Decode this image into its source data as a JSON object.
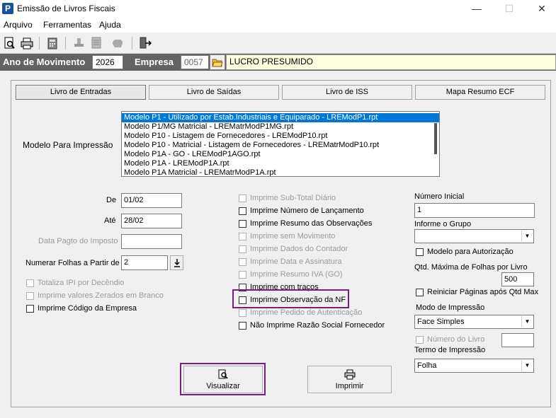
{
  "window": {
    "title": "Emissão de Livros Fiscais",
    "app_icon": "P"
  },
  "menu": [
    "Arquivo",
    "Ferramentas",
    "Ajuda"
  ],
  "header": {
    "ano_label": "Ano de Movimento",
    "ano_value": "2026",
    "empresa_label": "Empresa",
    "empresa_code": "0057",
    "empresa_name": "LUCRO PRESUMIDO"
  },
  "tabs": [
    "Livro de Entradas",
    "Livro de Saídas",
    "Livro de ISS",
    "Mapa Resumo ECF"
  ],
  "modelo": {
    "label": "Modelo Para Impressão",
    "items": [
      "Modelo P1 - Utilizado por Estab.Industriais e Equiparado - LREModP1.rpt",
      "Modelo P1/MG Matricial - LREMatrModP1MG.rpt",
      "Modelo P10 - Listagem de Fornecedores - LREModP10.rpt",
      "Modelo P10 - Matricial - Listagem de Fornecedores - LREMatrModP10.rpt",
      "Modelo P1A - GO - LREModP1AGO.rpt",
      "Modelo P1A - LREModP1A.rpt",
      "Modelo P1A Matricial - LREMatrModP1A.rpt"
    ]
  },
  "left": {
    "de_label": "De",
    "de_value": "01/02",
    "ate_label": "Até",
    "ate_value": "28/02",
    "data_pagto_label": "Data Pagto do Imposto",
    "data_pagto_value": "",
    "numerar_label": "Numerar Folhas a Partir de",
    "numerar_value": "2",
    "checks": [
      {
        "label": "Totaliza IPI por Decêndio",
        "disabled": true
      },
      {
        "label": "Imprime valores Zerados em Branco",
        "disabled": true
      },
      {
        "label": "Imprime Código da Empresa",
        "disabled": false
      }
    ]
  },
  "middle_checks": [
    {
      "label": "Imprime Sub-Total Diário",
      "disabled": true
    },
    {
      "label": "Imprime Número de Lançamento",
      "disabled": false
    },
    {
      "label": "Imprime Resumo das Observações",
      "disabled": false
    },
    {
      "label": "Imprime sem Movimento",
      "disabled": true
    },
    {
      "label": "Imprime Dados do Contador",
      "disabled": true
    },
    {
      "label": "Imprime Data e Assinatura",
      "disabled": true
    },
    {
      "label": "Imprime Resumo IVA (GO)",
      "disabled": true
    },
    {
      "label": "Imprime com traços",
      "disabled": false
    },
    {
      "label": "Imprime Observação da NF",
      "disabled": false
    },
    {
      "label": "Imprime Pedido de Autenticação",
      "disabled": true
    },
    {
      "label": "Não Imprime Razão Social Fornecedor",
      "disabled": false
    }
  ],
  "right": {
    "numero_inicial_label": "Número Inicial",
    "numero_inicial_value": "1",
    "grupo_label": "Informe o Grupo",
    "grupo_value": "",
    "modelo_autorizacao_label": "Modelo para Autorização",
    "qtd_max_label": "Qtd. Máxima de Folhas por Livro",
    "qtd_max_value": "500",
    "reiniciar_label": "Reiniciar Páginas após Qtd Max",
    "modo_label": "Modo de Impressão",
    "modo_value": "Face Simples",
    "numero_livro_label": "Número do Livro",
    "numero_livro_value": "",
    "termo_label": "Termo de Impressão",
    "termo_value": "Folha"
  },
  "buttons": {
    "visualizar": "Visualizar",
    "imprimir": "Imprimir"
  },
  "colors": {
    "highlight": "#7b1e7a",
    "selection": "#0078d7",
    "header_band": "#636363",
    "empresa_bg": "#ffffe0"
  }
}
